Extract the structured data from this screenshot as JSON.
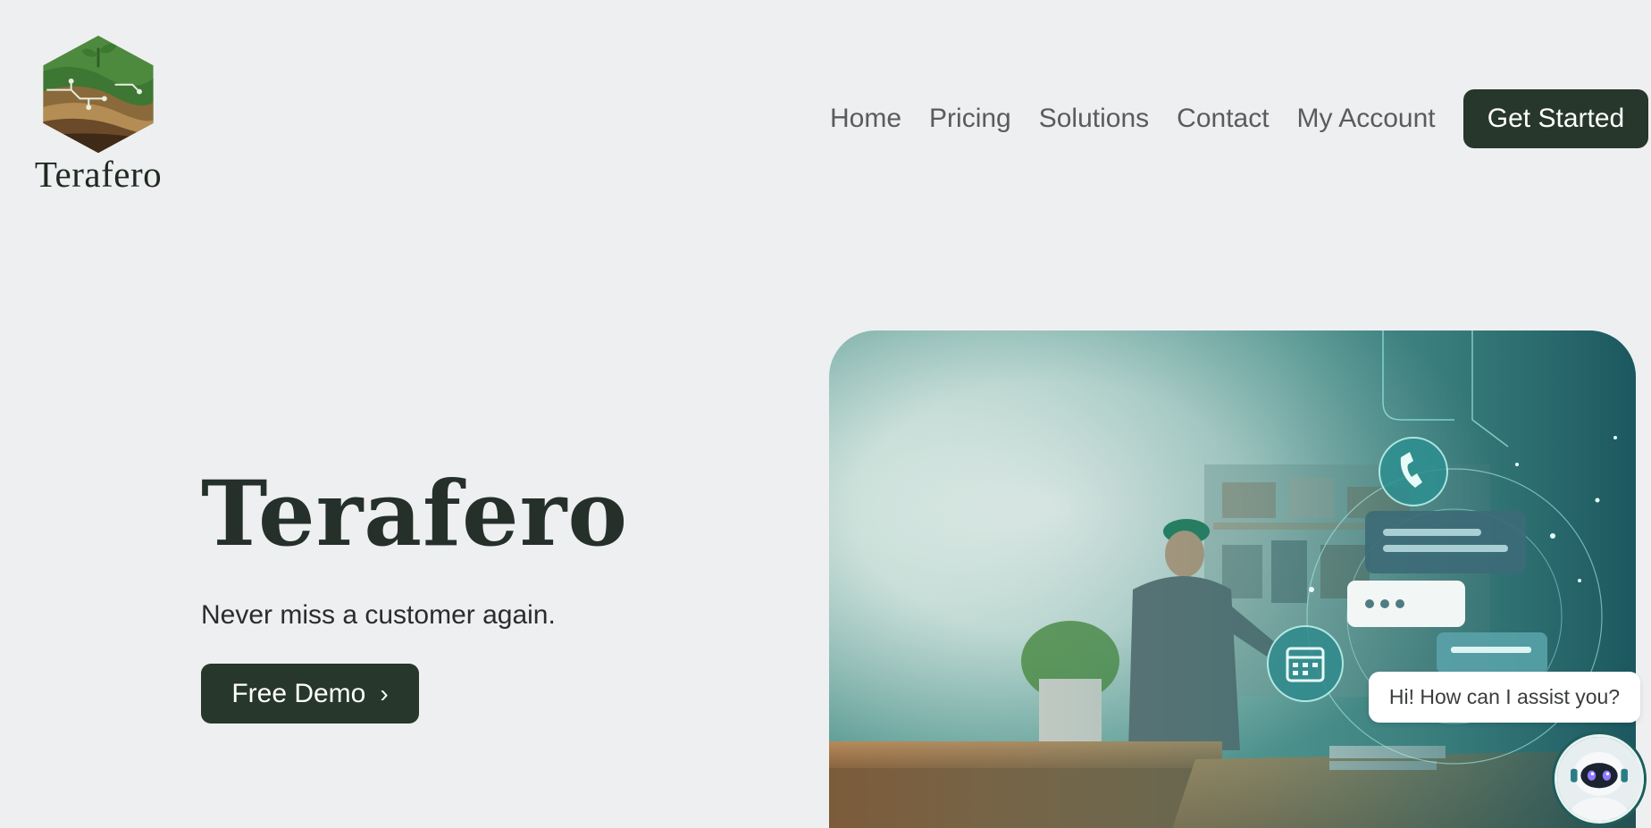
{
  "brand": {
    "name": "Terafero",
    "logo_icon": "leaf-hexagon-logo",
    "colors": {
      "primary": "#27372b",
      "background": "#eeeff1",
      "nav_text": "#5a5c5b"
    }
  },
  "nav": {
    "items": [
      {
        "label": "Home"
      },
      {
        "label": "Pricing"
      },
      {
        "label": "Solutions"
      },
      {
        "label": "Contact"
      },
      {
        "label": "My Account"
      }
    ],
    "cta_label": "Get Started"
  },
  "hero": {
    "title": "Terafero",
    "subtitle": "Never miss a customer again.",
    "button_label": "Free Demo",
    "button_icon": "chevron-right-icon",
    "image_description_icon": "workshop-communication-image"
  },
  "chat_widget": {
    "greeting": "Hi! How can I assist you?",
    "avatar_icon": "robot-assistant-icon"
  }
}
